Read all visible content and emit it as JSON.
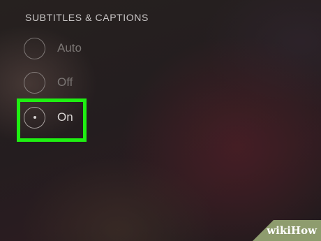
{
  "section": {
    "title": "SUBTITLES & CAPTIONS"
  },
  "options": [
    {
      "label": "Auto",
      "selected": false
    },
    {
      "label": "Off",
      "selected": false
    },
    {
      "label": "On",
      "selected": true
    }
  ],
  "highlight": {
    "color": "#1fef12",
    "target": "On"
  },
  "watermark": {
    "text": "wikiHow",
    "color": "#8e9c6e"
  }
}
